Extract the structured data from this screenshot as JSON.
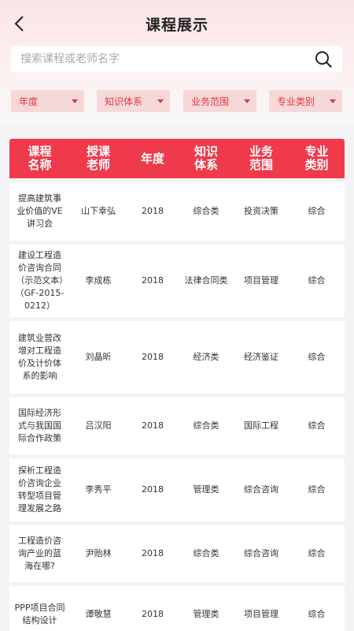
{
  "header": {
    "title": "课程展示"
  },
  "search": {
    "placeholder": "搜索课程或老师名字",
    "value": ""
  },
  "filters": [
    {
      "label": "年度"
    },
    {
      "label": "知识体系"
    },
    {
      "label": "业务范围"
    },
    {
      "label": "专业类别"
    }
  ],
  "table": {
    "columns": [
      "课程\n名称",
      "授课\n老师",
      "年度",
      "知识\n体系",
      "业务\n范围",
      "专业\n类别"
    ],
    "rows": [
      {
        "name": "提高建筑事业价值的VE讲习会",
        "teacher": "山下幸弘",
        "year": "2018",
        "system": "综合类",
        "scope": "投资决策",
        "category": "综合"
      },
      {
        "name": "建设工程造价咨询合同（示范文本）（GF-2015- 0212）",
        "teacher": "李成栋",
        "year": "2018",
        "system": "法律合同类",
        "scope": "项目管理",
        "category": "综合"
      },
      {
        "name": "建筑业营改增对工程造价及计价体系的影响",
        "teacher": "刘晶昕",
        "year": "2018",
        "system": "经济类",
        "scope": "经济鉴证",
        "category": "综合"
      },
      {
        "name": "国际经济形式与我国国际合作政策",
        "teacher": "吕汉阳",
        "year": "2018",
        "system": "综合类",
        "scope": "国际工程",
        "category": "综合"
      },
      {
        "name": "探析工程造价咨询企业转型项目管理发展之路",
        "teacher": "李秀平",
        "year": "2018",
        "system": "管理类",
        "scope": "综合咨询",
        "category": "综合"
      },
      {
        "name": "工程造价咨询产业的蓝海在哪?",
        "teacher": "尹贻林",
        "year": "2018",
        "system": "综合类",
        "scope": "综合咨询",
        "category": "综合"
      },
      {
        "name": "PPP项目合同结构设计",
        "teacher": "谭敬慧",
        "year": "2018",
        "system": "管理类",
        "scope": "项目管理",
        "category": "综合"
      }
    ]
  }
}
